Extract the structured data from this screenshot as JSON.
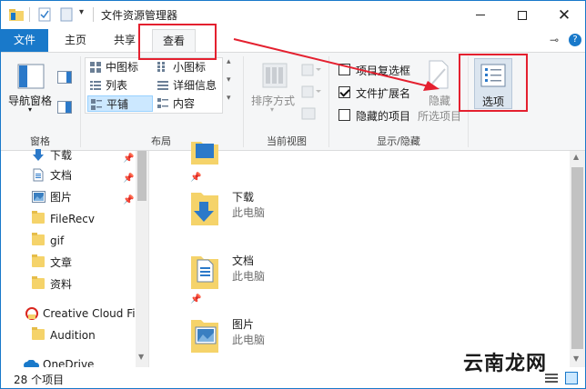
{
  "window": {
    "title": "文件资源管理器"
  },
  "tabs": {
    "file": "文件",
    "home": "主页",
    "share": "共享",
    "view": "查看"
  },
  "ribbon": {
    "pane": {
      "nav_pane": "导航窗格",
      "group_label": "窗格"
    },
    "layout": {
      "items": [
        "中图标",
        "小图标",
        "列表",
        "详细信息",
        "平铺",
        "内容"
      ],
      "group_label": "布局",
      "selected": "平铺"
    },
    "current_view": {
      "sort_by": "排序方式",
      "group_label": "当前视图"
    },
    "show_hide": {
      "item_checkboxes": "项目复选框",
      "file_extensions": "文件扩展名",
      "hidden_items": "隐藏的项目",
      "hide_selected_1": "隐藏",
      "hide_selected_2": "所选项目",
      "group_label": "显示/隐藏"
    },
    "options": {
      "label": "选项"
    }
  },
  "nav": {
    "items": [
      {
        "label": "下载",
        "pinned": true
      },
      {
        "label": "文档",
        "pinned": true
      },
      {
        "label": "图片",
        "pinned": true
      },
      {
        "label": "FileRecv"
      },
      {
        "label": "gif"
      },
      {
        "label": "文章"
      },
      {
        "label": "资料"
      },
      {
        "label": "Creative Cloud Fil"
      },
      {
        "label": "Audition"
      },
      {
        "label": "OneDrive"
      }
    ]
  },
  "content": {
    "tiles": [
      {
        "name": "下载",
        "location": "此电脑"
      },
      {
        "name": "文档",
        "location": "此电脑"
      },
      {
        "name": "图片",
        "location": "此电脑"
      }
    ]
  },
  "status": {
    "count": "28 个项目"
  },
  "watermark": "云南龙网",
  "colors": {
    "accent": "#1979ca",
    "highlight": "#e4202f"
  }
}
